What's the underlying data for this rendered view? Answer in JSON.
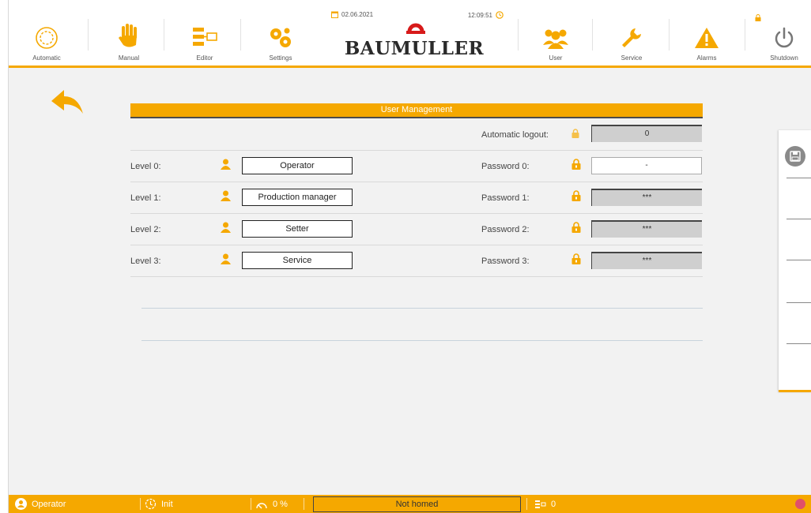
{
  "nav": {
    "automatic": "Automatic",
    "manual": "Manual",
    "editor": "Editor",
    "settings": "Settings",
    "user": "User",
    "service": "Service",
    "alarms": "Alarms",
    "shutdown": "Shutdown"
  },
  "brand": {
    "name": "BAUMULLER",
    "date": "02.06.2021",
    "time": "12:09:51"
  },
  "panel": {
    "title": "User Management",
    "auto_logout_label": "Automatic logout:",
    "auto_logout_value": "0",
    "levels": [
      {
        "label": "Level 0:",
        "name": "Operator",
        "pw_label": "Password 0:",
        "pw_value": "-"
      },
      {
        "label": "Level 1:",
        "name": "Production manager",
        "pw_label": "Password 1:",
        "pw_value": "***"
      },
      {
        "label": "Level 2:",
        "name": "Setter",
        "pw_label": "Password 2:",
        "pw_value": "***"
      },
      {
        "label": "Level 3:",
        "name": "Service",
        "pw_label": "Password 3:",
        "pw_value": "***"
      }
    ]
  },
  "status": {
    "user": "Operator",
    "state": "Init",
    "speed": "0 %",
    "homing": "Not homed",
    "program": "0"
  },
  "colors": {
    "accent": "#f5a800",
    "accent_dark": "#e08f00"
  },
  "icons": [
    "automatic-icon",
    "hand-icon",
    "editor-icon",
    "gears-icon",
    "users-icon",
    "wrench-icon",
    "alarm-icon",
    "power-icon",
    "lock-icon",
    "user-icon",
    "back-arrow-icon",
    "save-icon"
  ]
}
